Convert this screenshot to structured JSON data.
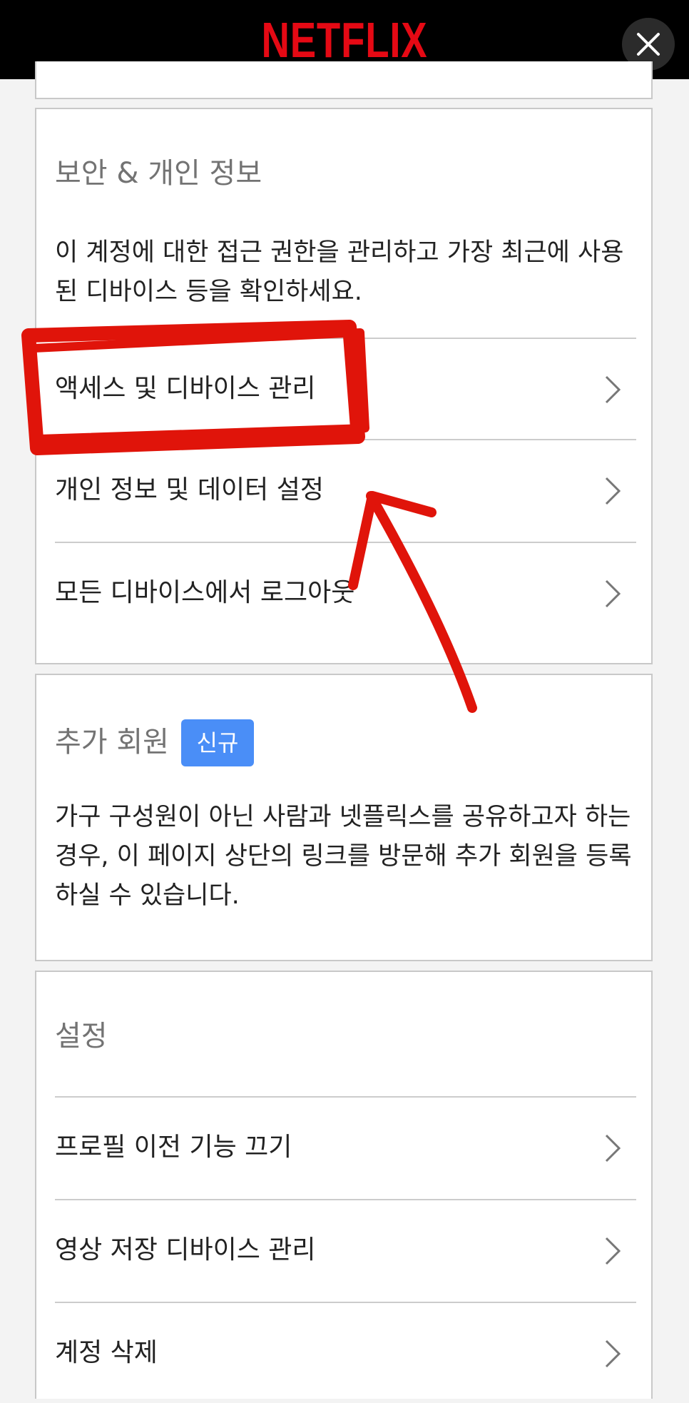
{
  "header": {
    "logo": "NETFLIX"
  },
  "security": {
    "title": "보안 & 개인 정보",
    "description": "이 계정에 대한 접근 권한을 관리하고 가장 최근에 사용된 디바이스 등을 확인하세요.",
    "items": [
      {
        "label": "액세스 및 디바이스 관리"
      },
      {
        "label": "개인 정보 및 데이터 설정"
      },
      {
        "label": "모든 디바이스에서 로그아웃"
      }
    ]
  },
  "extra_members": {
    "title": "추가 회원",
    "badge": "신규",
    "description": "가구 구성원이 아닌 사람과 넷플릭스를 공유하고자 하는 경우, 이 페이지 상단의 링크를 방문해 추가 회원을 등록하실 수 있습니다."
  },
  "settings": {
    "title": "설정",
    "items": [
      {
        "label": "프로필 이전 기능 끄기"
      },
      {
        "label": "영상 저장 디바이스 관리"
      },
      {
        "label": "계정 삭제"
      }
    ]
  },
  "colors": {
    "brand": "#e50914",
    "badge": "#4a8ef7",
    "annotation": "#e0140a"
  },
  "icons": {
    "close": "close-icon",
    "chevron": "chevron-right-icon"
  }
}
